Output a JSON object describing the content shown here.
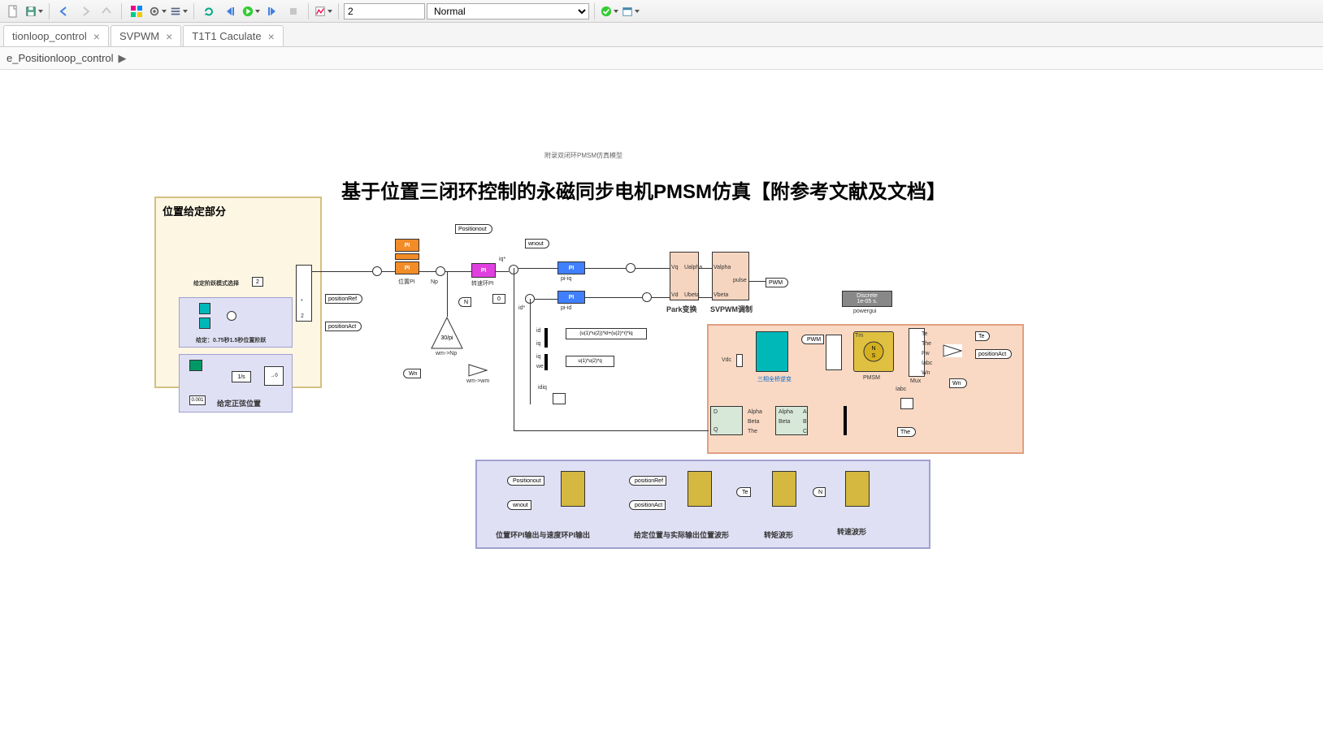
{
  "toolbar": {
    "stop_time": "2",
    "mode": "Normal"
  },
  "tabs": [
    {
      "label": "tionloop_control"
    },
    {
      "label": "SVPWM"
    },
    {
      "label": "T1T1 Caculate"
    }
  ],
  "breadcrumb": {
    "path": "e_Positionloop_control"
  },
  "model": {
    "small_title": "附录双闭环PMSM仿真模型",
    "big_title": "基于位置三闭环控制的永磁同步电机PMSM仿真【附参考文献及文档】",
    "pos_area_title": "位置给定部分",
    "mode_select_label": "给定阶跃模式选择",
    "mode_select_value": "2",
    "step_label": "给定：0.75秒1.5秒位置阶跃",
    "sine_label": "给定正弦位置",
    "sine_gain": "0.001",
    "switch_port": "2",
    "pos_pi_label": "位置PI",
    "speed_pi_label": "转速环PI",
    "iq_label": "pi-iq",
    "id_label": "pi-id",
    "id_ref": "0",
    "park_label": "Park变换",
    "svpwm_label": "SVPWM调制",
    "powergui_label": "powergui",
    "powergui_text": "Discrete\n1e-05 s.",
    "inverter_label": "三相全桥逆变",
    "pmsm_label": "PMSM",
    "mux_label": "Mux",
    "wm2np_label": "wm->Np",
    "wm2wm_label": "wm->wm",
    "np_gain": "30/pi",
    "iabc_label": "Iabc",
    "idiq_label": "idiq",
    "fcn1": "(u(1)^u(2))*id+(u(2)^r)*iq",
    "fcn2": "u(1)*u(2)*q",
    "tags": {
      "positionRef": "positionRef",
      "positionAct": "positionAct",
      "positionout": "Positionout",
      "wnout": "wnout",
      "wn": "Wn",
      "pwm": "PWM",
      "vdc": "Vdc",
      "te": "Te",
      "tm": "Tm",
      "the": "The",
      "n": "N",
      "ualpha": "Ualpha",
      "ubeta": "Ubeta",
      "valpha": "Valpha",
      "vbeta": "Vbeta",
      "vd": "Vd",
      "vq": "Vq",
      "iq_star": "iq*",
      "id_star": "id*",
      "iq": "iq",
      "id": "id",
      "we": "we",
      "np": "Np",
      "pulse": "pulse",
      "alpha": "Alpha",
      "beta": "Beta",
      "a": "A",
      "b": "B",
      "c": "C",
      "d": "D",
      "q": "Q"
    },
    "scopes": {
      "s1": "位置环PI输出与速度环PI输出",
      "s2": "给定位置与实际输出位置波形",
      "s3": "转矩波形",
      "s4": "转速波形"
    }
  }
}
